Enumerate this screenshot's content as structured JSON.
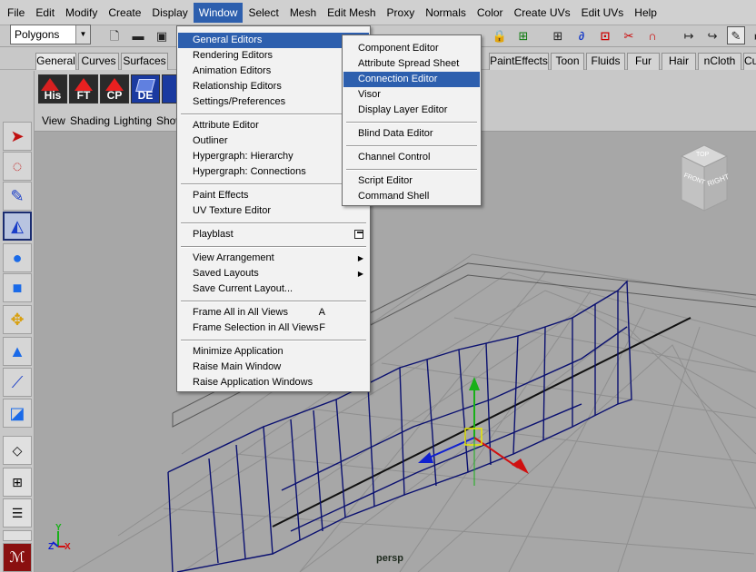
{
  "menubar": {
    "items": [
      "File",
      "Edit",
      "Modify",
      "Create",
      "Display",
      "Window",
      "Select",
      "Mesh",
      "Edit Mesh",
      "Proxy",
      "Normals",
      "Color",
      "Create UVs",
      "Edit UVs",
      "Help"
    ],
    "active_item": "Window"
  },
  "status_line": {
    "mode_value": "Polygons"
  },
  "shelf_tabs": {
    "left": [
      "General",
      "Curves",
      "Surfaces"
    ],
    "right": [
      "PaintEffects",
      "Toon",
      "Fluids",
      "Fur",
      "Hair",
      "nCloth",
      "Cu"
    ],
    "selected": "General"
  },
  "shelf": {
    "icons": [
      "His",
      "FT",
      "CP",
      "DE"
    ]
  },
  "panel_menu": {
    "items": [
      "View",
      "Shading",
      "Lighting",
      "Show"
    ]
  },
  "viewport": {
    "camera_label": "persp",
    "view_cube": {
      "top": "TOP",
      "front": "FRONT",
      "right": "RIGHT"
    },
    "axis_labels": {
      "x": "X",
      "y": "Y",
      "z": "Z"
    }
  },
  "window_menu": {
    "items": [
      {
        "label": "General Editors",
        "submenu": true,
        "highlighted": true
      },
      {
        "label": "Rendering Editors",
        "submenu": true
      },
      {
        "label": "Animation Editors",
        "submenu": true
      },
      {
        "label": "Relationship Editors",
        "submenu": true
      },
      {
        "label": "Settings/Preferences",
        "submenu": true
      },
      {
        "label": "Attribute Editor"
      },
      {
        "label": "Outliner"
      },
      {
        "label": "Hypergraph: Hierarchy"
      },
      {
        "label": "Hypergraph: Connections"
      },
      {
        "label": "Paint Effects"
      },
      {
        "label": "UV Texture Editor"
      },
      {
        "label": "Playblast",
        "option_box": true
      },
      {
        "label": "View Arrangement",
        "submenu": true
      },
      {
        "label": "Saved Layouts",
        "submenu": true
      },
      {
        "label": "Save Current Layout..."
      },
      {
        "label": "Frame All in All Views",
        "accelerator": "A"
      },
      {
        "label": "Frame Selection in All Views",
        "accelerator": "F"
      },
      {
        "label": "Minimize Application"
      },
      {
        "label": "Raise Main Window"
      },
      {
        "label": "Raise Application Windows"
      }
    ]
  },
  "general_editors_submenu": {
    "items": [
      {
        "label": "Component Editor"
      },
      {
        "label": "Attribute Spread Sheet"
      },
      {
        "label": "Connection Editor",
        "highlighted": true
      },
      {
        "label": "Visor"
      },
      {
        "label": "Display Layer Editor"
      },
      {
        "label": "Blind Data Editor"
      },
      {
        "label": "Channel Control"
      },
      {
        "label": "Script Editor"
      },
      {
        "label": "Command Shell"
      }
    ]
  },
  "colors": {
    "highlight": "#2d5fae",
    "viewport_bg": "#a7a7a7",
    "wireframe": "#0a1070"
  }
}
